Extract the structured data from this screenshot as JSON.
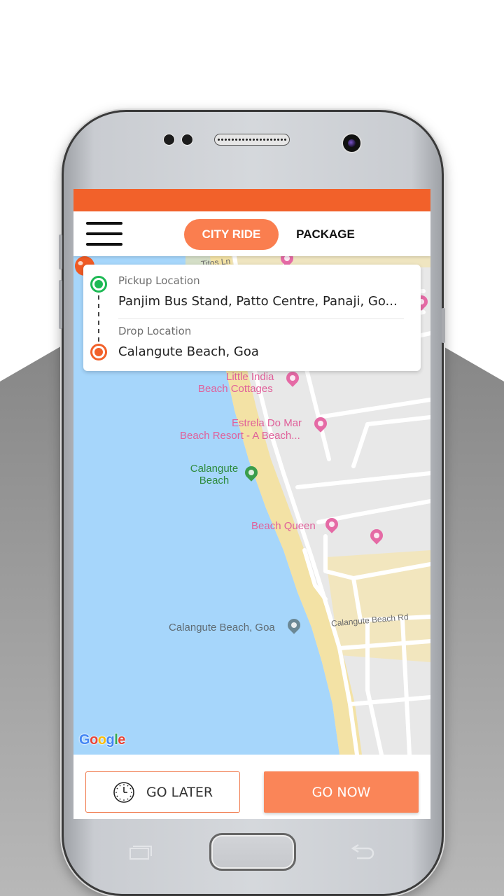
{
  "app": {
    "brand_color": "#f2612a",
    "accent_color": "#fa7e4f"
  },
  "header": {
    "menu_icon": "hamburger-menu-icon",
    "tabs": [
      {
        "label": "CITY RIDE",
        "active": true
      },
      {
        "label": "PACKAGE",
        "active": false
      }
    ]
  },
  "location_card": {
    "pickup": {
      "icon": "pickup-dot-icon",
      "label": "Pickup Location",
      "value": "Panjim Bus Stand, Patto Centre, Panaji, Go...",
      "color": "#1db954"
    },
    "drop": {
      "icon": "drop-dot-icon",
      "label": "Drop Location",
      "value": "Calangute Beach, Goa",
      "color": "#f2612a"
    }
  },
  "map": {
    "labels": {
      "titos_ln": "Titos Ln",
      "little_india_1": "Little India",
      "little_india_2": "Beach Cottages",
      "estrela_1": "Estrela Do Mar",
      "estrela_2": "Beach Resort - A Beach...",
      "calangute_1": "Calangute",
      "calangute_2": "Beach",
      "beach_queen": "Beach Queen",
      "calangute_goa": "Calangute Beach, Goa",
      "calangute_rd": "Calangute Beach Rd"
    },
    "attribution": [
      "G",
      "o",
      "o",
      "g",
      "l",
      "e"
    ],
    "marker_icon": "map-pin-icon"
  },
  "actions": {
    "go_later": {
      "label": "GO LATER",
      "icon": "clock-icon"
    },
    "go_now": {
      "label": "GO NOW"
    }
  },
  "device": {
    "nav": [
      "recents-icon",
      "home-button",
      "back-icon"
    ]
  }
}
